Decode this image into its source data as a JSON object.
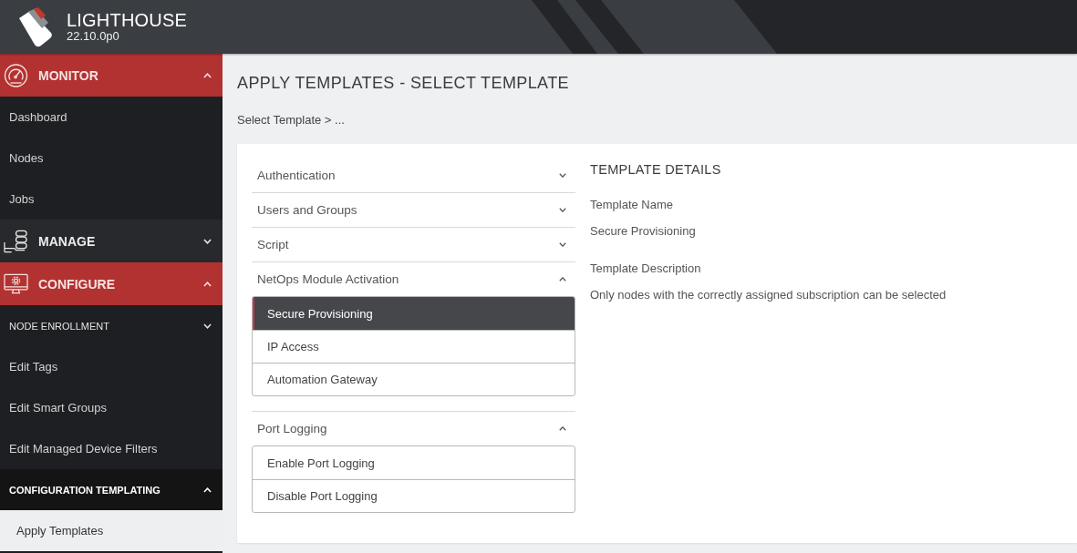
{
  "header": {
    "title": "LIGHTHOUSE",
    "version": "22.10.0p0"
  },
  "sidebar": {
    "sections": [
      {
        "label": "MONITOR",
        "expanded": true,
        "items": [
          {
            "kind": "link",
            "label": "Dashboard",
            "selected": false
          },
          {
            "kind": "link",
            "label": "Nodes",
            "selected": false
          },
          {
            "kind": "link",
            "label": "Jobs",
            "selected": false
          }
        ]
      },
      {
        "label": "MANAGE",
        "expanded": false
      },
      {
        "label": "CONFIGURE",
        "expanded": true,
        "items": [
          {
            "kind": "group",
            "label": "NODE ENROLLMENT",
            "expanded": false
          },
          {
            "kind": "link",
            "label": "Edit Tags",
            "selected": false
          },
          {
            "kind": "link",
            "label": "Edit Smart Groups",
            "selected": false
          },
          {
            "kind": "link",
            "label": "Edit Managed Device Filters",
            "selected": false
          },
          {
            "kind": "group",
            "label": "CONFIGURATION TEMPLATING",
            "expanded": true,
            "children": [
              {
                "kind": "link",
                "label": "Apply Templates",
                "selected": true
              }
            ]
          }
        ]
      }
    ]
  },
  "page": {
    "title": "APPLY TEMPLATES - SELECT TEMPLATE",
    "breadcrumb": "Select Template > ..."
  },
  "template_categories": [
    {
      "label": "Authentication",
      "expanded": false
    },
    {
      "label": "Users and Groups",
      "expanded": false
    },
    {
      "label": "Script",
      "expanded": false
    },
    {
      "label": "NetOps Module Activation",
      "expanded": true,
      "templates": [
        {
          "label": "Secure Provisioning",
          "selected": true
        },
        {
          "label": "IP Access",
          "selected": false
        },
        {
          "label": "Automation Gateway",
          "selected": false
        }
      ]
    },
    {
      "label": "Port Logging",
      "expanded": true,
      "templates": [
        {
          "label": "Enable Port Logging",
          "selected": false
        },
        {
          "label": "Disable Port Logging",
          "selected": false
        }
      ]
    }
  ],
  "template_details": {
    "heading": "TEMPLATE DETAILS",
    "fields": [
      {
        "label": "Template Name",
        "value": "Secure Provisioning"
      },
      {
        "label": "Template Description",
        "value": "Only nodes with the correctly assigned subscription can be selected"
      }
    ]
  }
}
